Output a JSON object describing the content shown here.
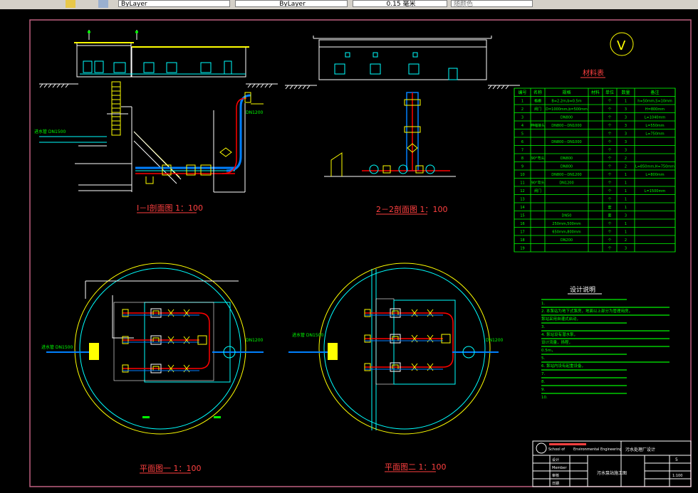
{
  "toolbar": {
    "layer_combo": "ByLayer",
    "linetype_combo": "ByLayer",
    "lineweight_combo": "0.15 毫米",
    "plotstyle_combo": "随颜色"
  },
  "drawing": {
    "section1_title": "I－I剖面图 1：100",
    "section2_title": "2－2剖面图 1：100",
    "plan1_title": "平面图一 1：100",
    "plan2_title": "平面图二 1：100",
    "inlet_label": "进水管 DN1500",
    "outlet_label": "DN1200",
    "north_symbol": "V",
    "material_table": {
      "title": "材料表",
      "headers": [
        "编号",
        "名称",
        "规格",
        "材料",
        "单位",
        "数量",
        "备注"
      ],
      "rows": [
        [
          "1",
          "格栅",
          "B=2.2m,b=0.5m",
          "",
          "个",
          "1",
          "h=50mm,S=10mm"
        ],
        [
          "2",
          "闸门",
          "D=1000mm,b=500mm",
          "",
          "个",
          "3",
          "H=800mm"
        ],
        [
          "3",
          "",
          "DN800",
          "",
          "个",
          "3",
          "L=1040mm"
        ],
        [
          "4",
          "伸缩接头",
          "DN800－DN1000",
          "",
          "个",
          "3",
          "L=550mm"
        ],
        [
          "5",
          "",
          "",
          "",
          "个",
          "3",
          "L=750mm"
        ],
        [
          "6",
          "",
          "DN800－DN1000",
          "",
          "个",
          "3",
          ""
        ],
        [
          "7",
          "",
          "",
          "",
          "个",
          "3",
          ""
        ],
        [
          "8",
          "90°弯头",
          "DN800",
          "",
          "个",
          "2",
          ""
        ],
        [
          "9",
          "",
          "DN800",
          "",
          "个",
          "2",
          "L=850mm,H=750mm"
        ],
        [
          "10",
          "",
          "DN800－DN1200",
          "",
          "个",
          "1",
          "L=800mm"
        ],
        [
          "11",
          "90°弯头",
          "DN1200",
          "",
          "个",
          "1",
          ""
        ],
        [
          "12",
          "闸门",
          "",
          "",
          "个",
          "1",
          "L=1500mm"
        ],
        [
          "13",
          "",
          "",
          "",
          "个",
          "1",
          ""
        ],
        [
          "14",
          "",
          "",
          "",
          "套",
          "1",
          ""
        ],
        [
          "15",
          "",
          "DN50",
          "",
          "套",
          "3",
          ""
        ],
        [
          "16",
          "",
          "250mm,500mm",
          "",
          "个",
          "1",
          ""
        ],
        [
          "17",
          "",
          "650mm,800mm",
          "",
          "个",
          "1",
          ""
        ],
        [
          "18",
          "",
          "DN200",
          "",
          "个",
          "2",
          ""
        ],
        [
          "19",
          "",
          "",
          "",
          "个",
          "3",
          ""
        ]
      ]
    },
    "notes": {
      "title": "设计说明",
      "lines": [
        "1.",
        "2. 本泵站为地下式泵房，地面以上部分为管理用房，",
        "   泵站采用自灌式启动，",
        "3.",
        "4. 泵站设有潜水泵，",
        "   设计流量，扬程，",
        "   0.5m，",
        "5.",
        "6. 泵站内设有起重设备，",
        "7.",
        "8.",
        "9.",
        "10."
      ]
    },
    "title_block": {
      "school": "School of ",
      "department": "Environmental Engineering",
      "project": "污水处理厂设计",
      "drawing_name": "污水泵站施工图",
      "scale": "1:100",
      "sheet_no": "5",
      "row_labels": [
        "设计",
        "Member",
        "审核",
        "日期"
      ],
      "row_values": [
        "",
        "",
        "",
        ""
      ]
    }
  }
}
